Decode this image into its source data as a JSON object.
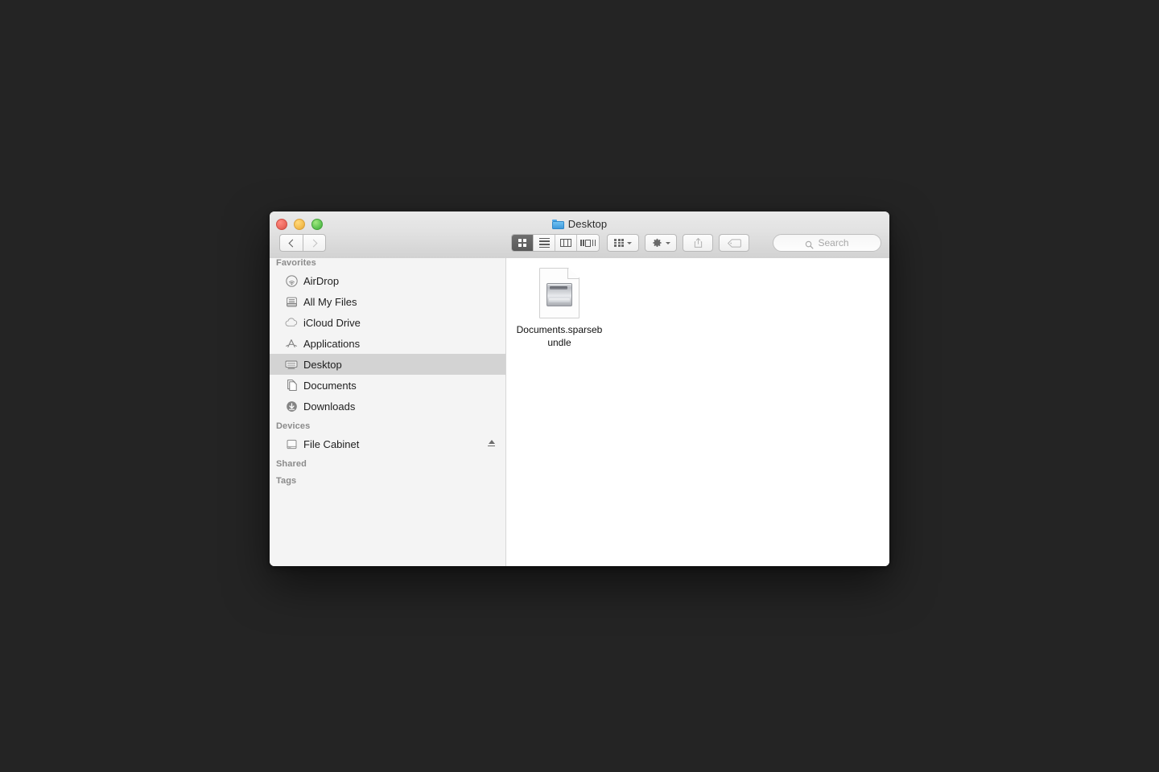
{
  "desktop": {
    "background_color": "#242424"
  },
  "window": {
    "title": "Desktop",
    "title_icon": "blue-folder-icon",
    "traffic_lights": [
      {
        "name": "close-button",
        "color": "#ec6a5f"
      },
      {
        "name": "minimize-button",
        "color": "#f4bd4f"
      },
      {
        "name": "zoom-button",
        "color": "#61c554"
      }
    ]
  },
  "toolbar": {
    "back_label": "Back",
    "forward_label": "Forward",
    "view_modes": [
      {
        "name": "icon-view",
        "label": "Icon View",
        "selected": true
      },
      {
        "name": "list-view",
        "label": "List View",
        "selected": false
      },
      {
        "name": "column-view",
        "label": "Column View",
        "selected": false
      },
      {
        "name": "coverflow-view",
        "label": "Cover Flow View",
        "selected": false
      }
    ],
    "arrange_label": "Arrange",
    "action_label": "Action",
    "share_label": "Share",
    "tag_label": "Edit Tags"
  },
  "search": {
    "placeholder": "Search",
    "value": "",
    "icon": "search-icon"
  },
  "sidebar": {
    "sections": [
      {
        "header": "Favorites",
        "items": [
          {
            "label": "AirDrop",
            "icon": "airdrop-icon",
            "selected": false
          },
          {
            "label": "All My Files",
            "icon": "all-my-files-icon",
            "selected": false
          },
          {
            "label": "iCloud Drive",
            "icon": "icloud-icon",
            "selected": false
          },
          {
            "label": "Applications",
            "icon": "applications-icon",
            "selected": false
          },
          {
            "label": "Desktop",
            "icon": "desktop-icon",
            "selected": true
          },
          {
            "label": "Documents",
            "icon": "documents-icon",
            "selected": false
          },
          {
            "label": "Downloads",
            "icon": "downloads-icon",
            "selected": false
          }
        ]
      },
      {
        "header": "Devices",
        "items": [
          {
            "label": "File Cabinet",
            "icon": "external-drive-icon",
            "selected": false,
            "eject": true
          }
        ]
      },
      {
        "header": "Shared",
        "items": []
      },
      {
        "header": "Tags",
        "items": []
      }
    ]
  },
  "content": {
    "files": [
      {
        "name": "Documents.sparsebundle",
        "icon": "sparsebundle-document-icon",
        "selected": false
      }
    ]
  }
}
